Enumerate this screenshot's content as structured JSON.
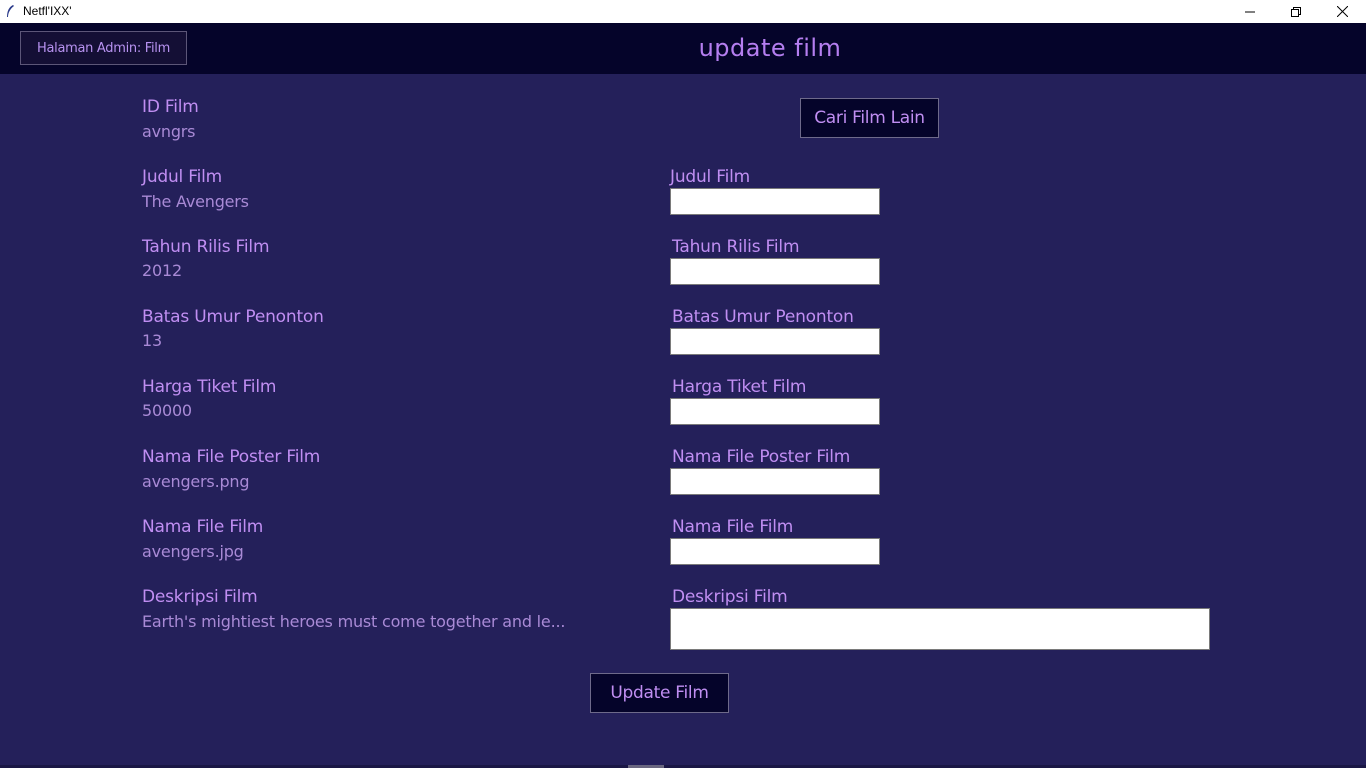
{
  "window": {
    "title": "Netfl'IXX'",
    "icons": {
      "app": "feather-icon",
      "minimize": "minimize-icon",
      "maximize": "restore-icon",
      "close": "close-icon"
    }
  },
  "header": {
    "admin_button": "Halaman Admin: Film",
    "title": "update film"
  },
  "current": {
    "id_label": "ID Film",
    "id_value": "avngrs",
    "judul_label": "Judul Film",
    "judul_value": "The Avengers",
    "tahun_label": "Tahun Rilis Film",
    "tahun_value": "2012",
    "umur_label": "Batas Umur Penonton",
    "umur_value": "13",
    "harga_label": "Harga Tiket Film",
    "harga_value": "50000",
    "poster_label": "Nama File Poster Film",
    "poster_value": "avengers.png",
    "file_label": "Nama File Film",
    "file_value": "avengers.jpg",
    "deskripsi_label": "Deskripsi Film",
    "deskripsi_value": "Earth's mightiest heroes must come together and le..."
  },
  "form": {
    "cari_button": "Cari Film Lain",
    "judul_label": "Judul Film",
    "judul_value": "",
    "tahun_label": "Tahun Rilis Film",
    "tahun_value": "",
    "umur_label": "Batas Umur Penonton",
    "umur_value": "",
    "harga_label": "Harga Tiket Film",
    "harga_value": "",
    "poster_label": "Nama File Poster Film",
    "poster_value": "",
    "file_label": "Nama File Film",
    "file_value": "",
    "deskripsi_label": "Deskripsi Film",
    "deskripsi_value": "",
    "update_button": "Update Film"
  },
  "colors": {
    "background": "#24205a",
    "header": "#05042a",
    "label": "#c08ef2",
    "value": "#a98ad6"
  }
}
